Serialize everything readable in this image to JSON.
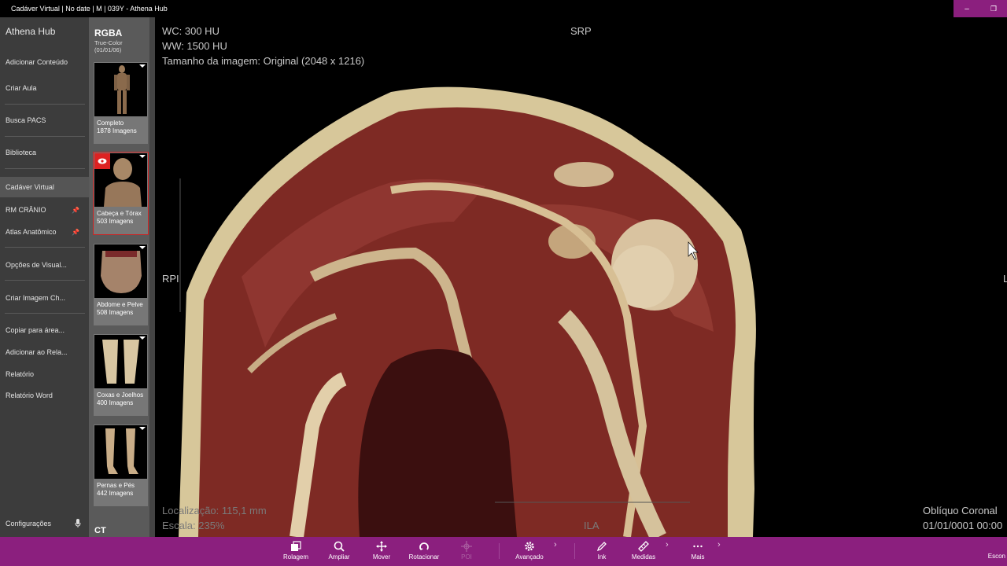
{
  "window": {
    "title": "Cadáver Virtual | No date | M | 039Y - Athena Hub",
    "minimize_icon": "minimize-icon",
    "restore_icon": "restore-icon"
  },
  "nav": {
    "app_title": "Athena Hub",
    "items": [
      {
        "label": "Adicionar Conteúdo"
      },
      {
        "label": "Criar Aula"
      },
      {
        "label": "Busca PACS"
      },
      {
        "label": "Biblioteca"
      },
      {
        "label": "Cadáver Virtual"
      },
      {
        "label": "RM CRÂNIO"
      },
      {
        "label": "Atlas Anatômico"
      },
      {
        "label": "Opções de Visual..."
      },
      {
        "label": "Criar Imagem Ch..."
      },
      {
        "label": "Copiar para área..."
      },
      {
        "label": "Adicionar ao Rela..."
      },
      {
        "label": "Relatório"
      },
      {
        "label": "Relatório Word"
      },
      {
        "label": "Configurações"
      }
    ]
  },
  "series_panel": {
    "header": "RGBA",
    "subtitle": "True-Color",
    "date": "(01/01/06)",
    "thumbs": [
      {
        "name": "Completo",
        "count": "1878 Imagens"
      },
      {
        "name": "Cabeça e Tórax",
        "count": "503 Imagens"
      },
      {
        "name": "Abdome e Pelve",
        "count": "508 Imagens"
      },
      {
        "name": "Coxas e Joelhos",
        "count": "400 Imagens"
      },
      {
        "name": "Pernas e Pés",
        "count": "442 Imagens"
      }
    ],
    "next_group": "CT"
  },
  "viewer": {
    "wc": "WC: 300 HU",
    "ww": "WW: 1500 HU",
    "image_size": "Tamanho da imagem: Original (2048 x 1216)",
    "orient_top": "SRP",
    "orient_left": "RPI",
    "orient_right": "L",
    "orient_bottom": "ILA",
    "location": "Localização: 115,1 mm",
    "scale": "Escala: 235%",
    "plane": "Oblíquo Coronal",
    "datetime": "01/01/0001 00:00"
  },
  "toolbar": {
    "tools": [
      {
        "label": "Rolagem",
        "icon": "layers-icon"
      },
      {
        "label": "Ampliar",
        "icon": "zoom-icon"
      },
      {
        "label": "Mover",
        "icon": "move-icon"
      },
      {
        "label": "Rotacionar",
        "icon": "rotate-icon"
      },
      {
        "label": "POI",
        "icon": "crosshair-icon"
      },
      {
        "label": "Avançado",
        "icon": "gear-icon"
      },
      {
        "label": "Ink",
        "icon": "pen-icon"
      },
      {
        "label": "Medidas",
        "icon": "ruler-icon"
      },
      {
        "label": "Mais",
        "icon": "more-icon"
      }
    ],
    "right_label": "Escon"
  }
}
